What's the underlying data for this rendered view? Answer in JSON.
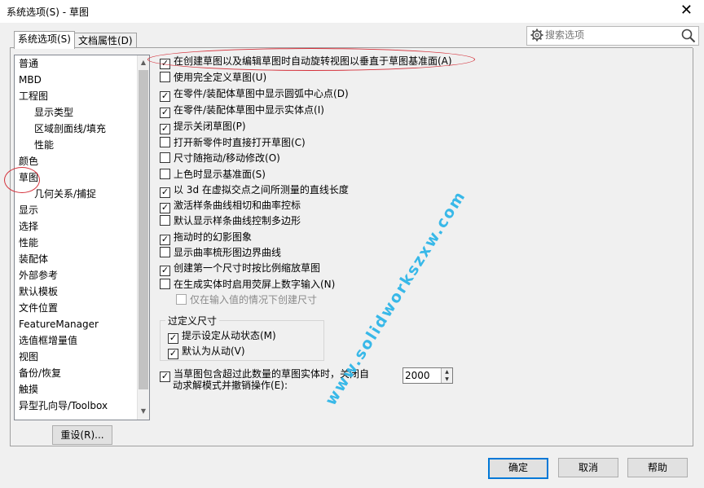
{
  "window": {
    "title": "系统选项(S) - 草图",
    "close_glyph": "✕"
  },
  "tabs": [
    {
      "label": "系统选项(S)",
      "active": true
    },
    {
      "label": "文档属性(D)",
      "active": false
    }
  ],
  "search": {
    "placeholder": "搜索选项",
    "icon": "search-icon",
    "options_icon": "gear-icon"
  },
  "tree": {
    "items": [
      {
        "label": "普通",
        "level": 1
      },
      {
        "label": "MBD",
        "level": 1
      },
      {
        "label": "工程图",
        "level": 1
      },
      {
        "label": "显示类型",
        "level": 2
      },
      {
        "label": "区域剖面线/填充",
        "level": 2
      },
      {
        "label": "性能",
        "level": 2
      },
      {
        "label": "颜色",
        "level": 1
      },
      {
        "label": "草图",
        "level": 1,
        "selected": true
      },
      {
        "label": "几何关系/捕捉",
        "level": 2
      },
      {
        "label": "显示",
        "level": 1
      },
      {
        "label": "选择",
        "level": 1
      },
      {
        "label": "性能",
        "level": 1
      },
      {
        "label": "装配体",
        "level": 1
      },
      {
        "label": "外部参考",
        "level": 1
      },
      {
        "label": "默认模板",
        "level": 1
      },
      {
        "label": "文件位置",
        "level": 1
      },
      {
        "label": "FeatureManager",
        "level": 1
      },
      {
        "label": "选值框增量值",
        "level": 1
      },
      {
        "label": "视图",
        "level": 1
      },
      {
        "label": "备份/恢复",
        "level": 1
      },
      {
        "label": "触摸",
        "level": 1
      },
      {
        "label": "异型孔向导/Toolbox",
        "level": 1
      }
    ]
  },
  "options": [
    {
      "label": "在创建草图以及编辑草图时自动旋转视图以垂直于草图基准面(A)",
      "checked": true
    },
    {
      "label": "使用完全定义草图(U)",
      "checked": false
    },
    {
      "label": "在零件/装配体草图中显示圆弧中心点(D)",
      "checked": true
    },
    {
      "label": "在零件/装配体草图中显示实体点(I)",
      "checked": true
    },
    {
      "label": "提示关闭草图(P)",
      "checked": true
    },
    {
      "label": "打开新零件时直接打开草图(C)",
      "checked": false
    },
    {
      "label": "尺寸随拖动/移动修改(O)",
      "checked": false
    },
    {
      "label": "上色时显示基准面(S)",
      "checked": false
    },
    {
      "label": "以 3d 在虚拟交点之间所测量的直线长度",
      "checked": true
    },
    {
      "label": "激活样条曲线相切和曲率控标",
      "checked": true
    },
    {
      "label": "默认显示样条曲线控制多边形",
      "checked": false
    },
    {
      "label": "拖动时的幻影图象",
      "checked": true
    },
    {
      "label": "显示曲率梳形图边界曲线",
      "checked": false
    },
    {
      "label": "创建第一个尺寸时按比例缩放草图",
      "checked": true
    },
    {
      "label": "在生成实体时启用荧屏上数字输入(N)",
      "checked": false
    }
  ],
  "sub_option": {
    "label": "仅在输入值的情况下创建尺寸",
    "checked": false,
    "enabled": false
  },
  "overdefine_group": {
    "title": "过定义尺寸",
    "items": [
      {
        "label": "提示设定从动状态(M)",
        "checked": true
      },
      {
        "label": "默认为从动(V)",
        "checked": true
      }
    ]
  },
  "limit_option": {
    "line1": "当草图包含超过此数量的草图实体时，关闭自",
    "line2": "动求解模式并撤销操作(E):",
    "checked": true,
    "value": "2000"
  },
  "buttons": {
    "reset": "重设(R)...",
    "ok": "确定",
    "cancel": "取消",
    "help": "帮助"
  },
  "watermark": "www.solidworkszxw.com",
  "colors": {
    "accent": "#0078d7",
    "annotation_red": "#d4303a",
    "watermark": "#2fb6e8"
  }
}
